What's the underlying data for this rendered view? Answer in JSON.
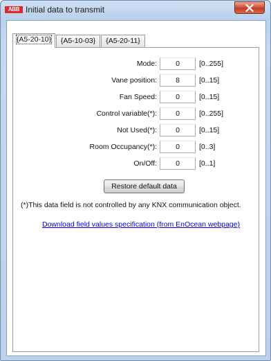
{
  "window": {
    "title": "Initial data to transmit",
    "logo_text": "ABB",
    "close_label": "X"
  },
  "tabs": [
    {
      "label": "{A5-20-10}",
      "selected": true
    },
    {
      "label": "{A5-10-03}",
      "selected": false
    },
    {
      "label": "{A5-20-11}",
      "selected": false
    }
  ],
  "fields": [
    {
      "label": "Mode:",
      "value": "0",
      "range": "[0..255]"
    },
    {
      "label": "Vane position:",
      "value": "8",
      "range": "[0..15]"
    },
    {
      "label": "Fan Speed:",
      "value": "0",
      "range": "[0..15]"
    },
    {
      "label": "Control variable(*):",
      "value": "0",
      "range": "[0..255]"
    },
    {
      "label": "Not Used(*):",
      "value": "0",
      "range": "[0..15]"
    },
    {
      "label": "Room Occupancy(*):",
      "value": "0",
      "range": "[0..3]"
    },
    {
      "label": "On/Off:",
      "value": "0",
      "range": "[0..1]"
    }
  ],
  "restore_button": "Restore default data",
  "note": "(*)This data field is not controlled by any KNX communication object.",
  "link": "Download field values specification (from EnOcean webpage)",
  "colors": {
    "titlebar": "#c4d8ef",
    "close_button": "#c23b22",
    "link": "#0000ee",
    "logo": "#e3242b"
  }
}
